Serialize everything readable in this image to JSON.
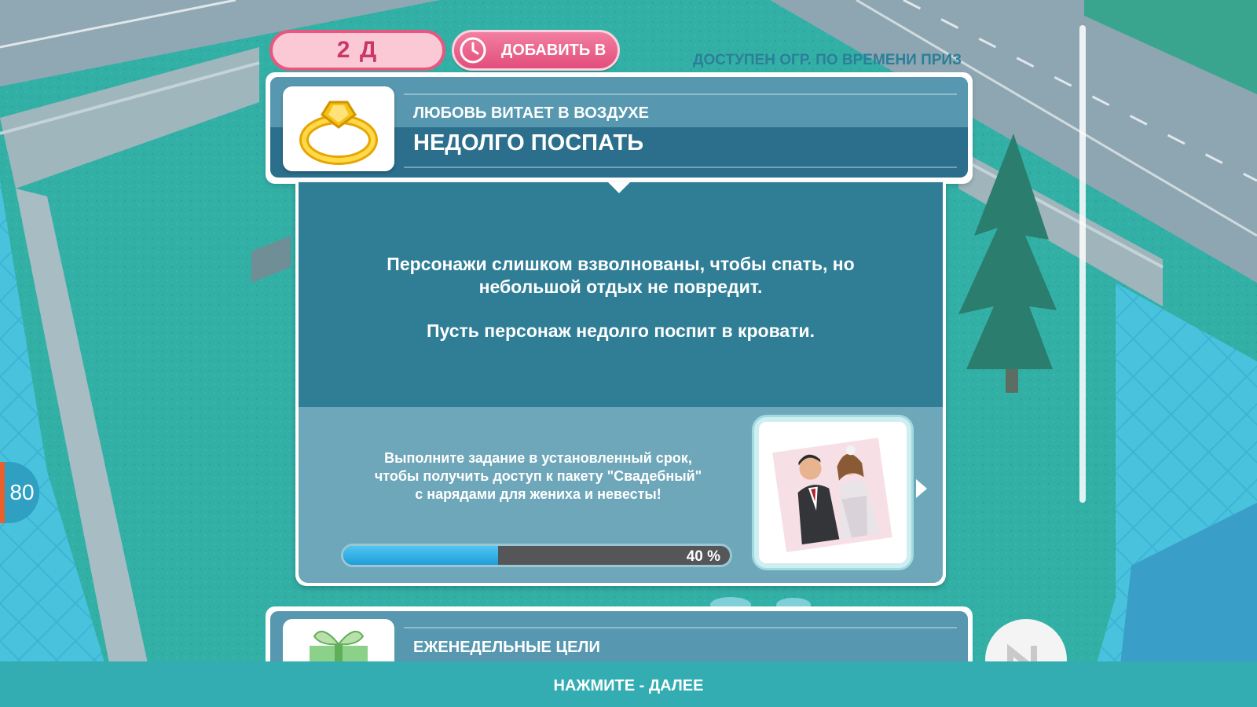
{
  "hud": {
    "level": "80"
  },
  "quest": {
    "timer": "2 Д",
    "add_time_label": "ДОБАВИТЬ В",
    "prize_caption": "ДОСТУПЕН ОГР. ПО ВРЕМЕНИ ПРИЗ",
    "category": "ЛЮБОВЬ ВИТАЕТ В ВОЗДУХЕ",
    "title": "НЕДОЛГО ПОСПАТЬ",
    "description_line1": "Персонажи слишком взволнованы, чтобы спать, но",
    "description_line2": "небольшой отдых не повредит.",
    "instruction": "Пусть персонаж недолго поспит в кровати.",
    "reward_line1": "Выполните задание в установленный срок,",
    "reward_line2": "чтобы получить доступ к пакету \"Свадебный\"",
    "reward_line3": "с нарядами для жениха и невесты!",
    "progress_percent": 40,
    "progress_label": "40 %"
  },
  "weekly": {
    "label": "ЕЖЕНЕДЕЛЬНЫЕ ЦЕЛИ"
  },
  "footer": {
    "tap_next": "НАЖМИТЕ - ДАЛЕЕ"
  },
  "colors": {
    "accent_pink": "#e24e7b",
    "panel_dark": "#2c6f8c",
    "panel_light": "#5798b0",
    "progress_blue": "#1e9ed8",
    "level_orange": "#e8612c"
  },
  "icons": {
    "header": "wedding-ring-icon",
    "weekly": "gift-box-icon",
    "add_time": "clock-icon"
  }
}
